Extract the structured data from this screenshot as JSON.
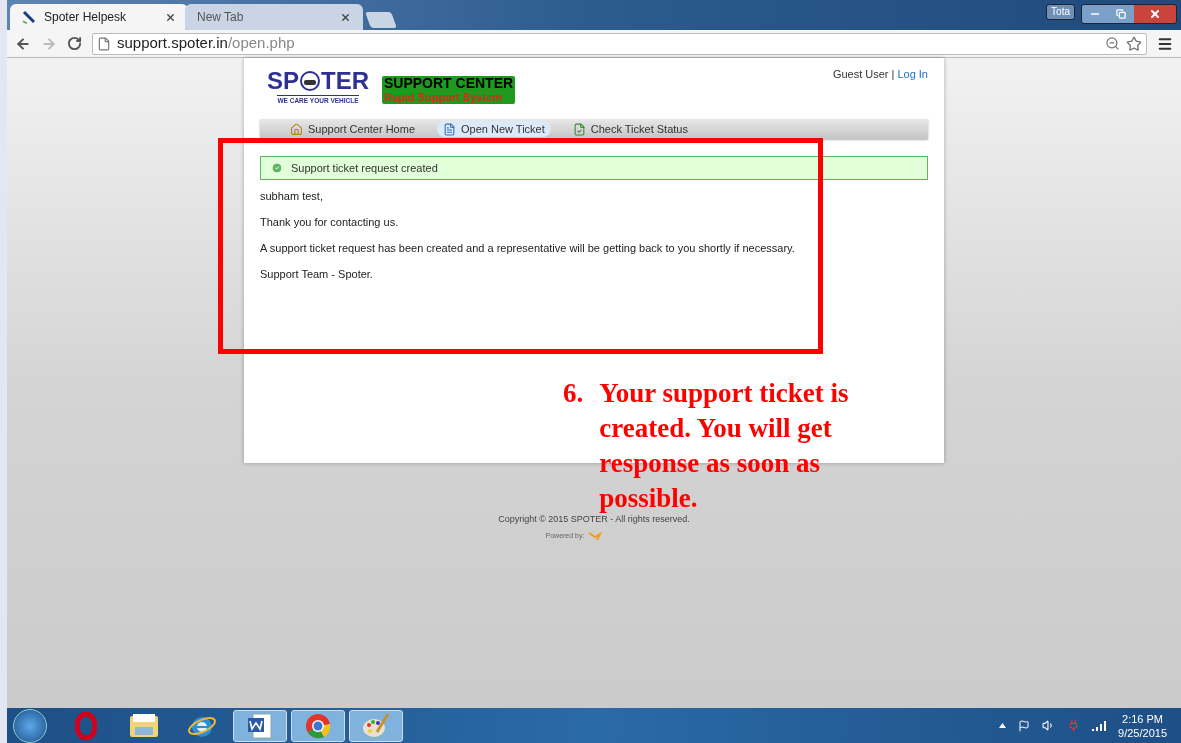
{
  "browser": {
    "tabs": [
      {
        "title": "Spoter Helpesk",
        "selected": true
      },
      {
        "title": "New Tab",
        "selected": false
      }
    ],
    "user_button": "Tota",
    "address": {
      "host": "support.spoter.in",
      "path": "/open.php"
    }
  },
  "page": {
    "logo": {
      "left": "SP",
      "right": "TER",
      "tagline": "WE CARE YOUR VEHICLE"
    },
    "banner": {
      "title": "SUPPORT CENTER",
      "subtitle": "Rapid Support System"
    },
    "user": "Guest User",
    "separator": "|",
    "login": "Log In",
    "nav": [
      {
        "label": "Support Center Home",
        "kind": "home",
        "selected": false
      },
      {
        "label": "Open New Ticket",
        "kind": "new",
        "selected": true
      },
      {
        "label": "Check Ticket Status",
        "kind": "status",
        "selected": false
      }
    ],
    "notice": "Support ticket request created",
    "messages": [
      "subham test,",
      "Thank you for contacting us.",
      "A support ticket request has been created and a representative will be getting back to you shortly if necessary.",
      "Support Team - Spoter."
    ],
    "footer": {
      "copyright": "Copyright © 2015 SPOTER - All rights reserved.",
      "powered_by": "Powered by:"
    }
  },
  "annotation": {
    "number": "6.",
    "text": "Your support ticket is created. You will get response as soon as possible."
  },
  "taskbar": {
    "apps": [
      {
        "kind": "opera",
        "running": false
      },
      {
        "kind": "folder",
        "running": false
      },
      {
        "kind": "ie",
        "running": false
      },
      {
        "kind": "word",
        "running": true
      },
      {
        "kind": "chrome",
        "running": true
      },
      {
        "kind": "paint",
        "running": true
      }
    ],
    "time": "2:16 PM",
    "date": "9/25/2015"
  }
}
